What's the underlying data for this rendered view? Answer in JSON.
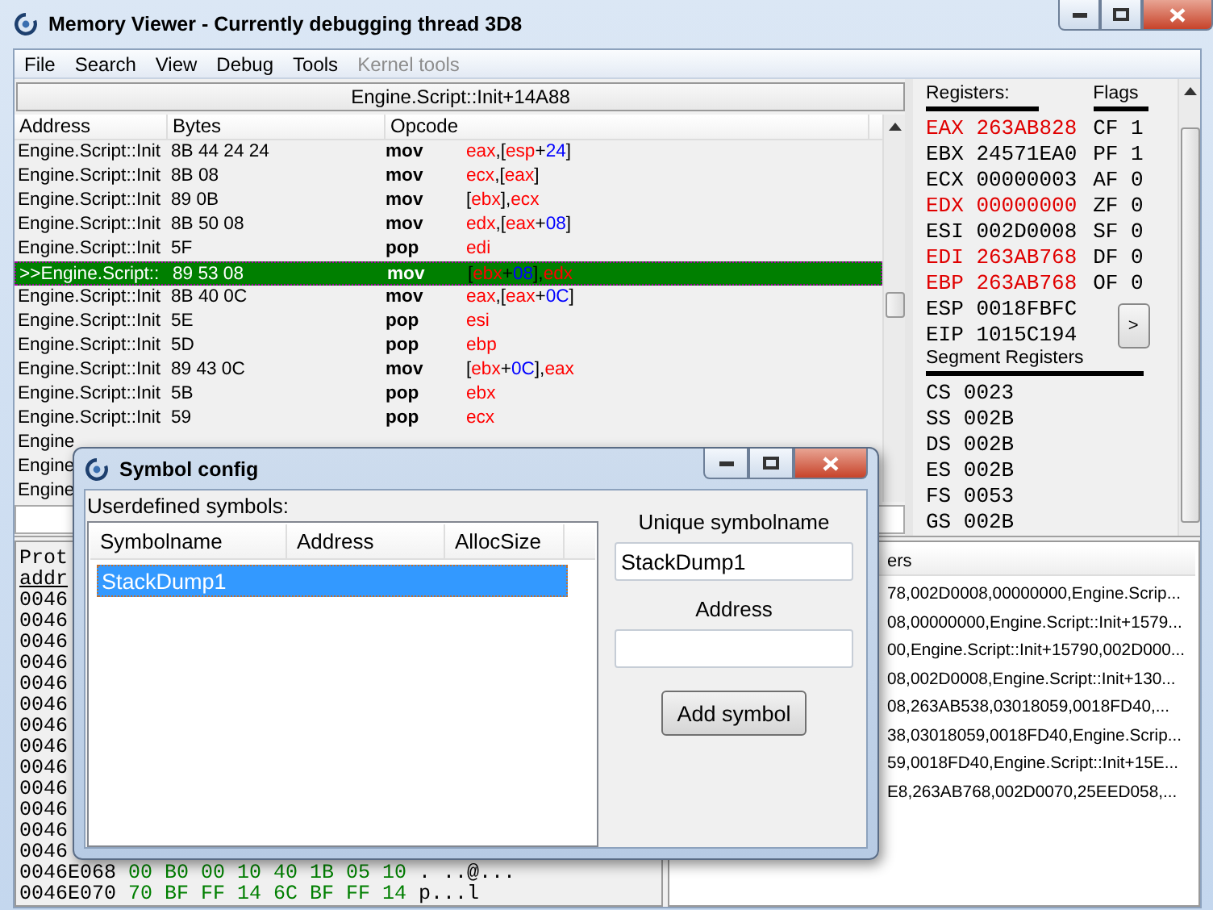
{
  "window": {
    "title": "Memory Viewer - Currently debugging thread 3D8"
  },
  "menu": [
    {
      "label": "File",
      "disabled": false
    },
    {
      "label": "Search",
      "disabled": false
    },
    {
      "label": "View",
      "disabled": false
    },
    {
      "label": "Debug",
      "disabled": false
    },
    {
      "label": "Tools",
      "disabled": false
    },
    {
      "label": "Kernel tools",
      "disabled": true
    }
  ],
  "address_bar": "Engine.Script::Init+14A88",
  "disassembly": {
    "columns": [
      "Address",
      "Bytes",
      "Opcode"
    ],
    "rows": [
      {
        "address": "Engine.Script::Init",
        "bytes": "8B 44 24 24",
        "mnemonic": "mov",
        "operands": [
          {
            "text": "eax",
            "kind": "reg"
          },
          {
            "text": ",[",
            "kind": "sym"
          },
          {
            "text": "esp",
            "kind": "reg"
          },
          {
            "text": "+",
            "kind": "sym"
          },
          {
            "text": "24",
            "kind": "num"
          },
          {
            "text": "]",
            "kind": "sym"
          }
        ],
        "selected": false
      },
      {
        "address": "Engine.Script::Init",
        "bytes": "8B 08",
        "mnemonic": "mov",
        "operands": [
          {
            "text": "ecx",
            "kind": "reg"
          },
          {
            "text": ",[",
            "kind": "sym"
          },
          {
            "text": "eax",
            "kind": "reg"
          },
          {
            "text": "]",
            "kind": "sym"
          }
        ],
        "selected": false
      },
      {
        "address": "Engine.Script::Init",
        "bytes": "89 0B",
        "mnemonic": "mov",
        "operands": [
          {
            "text": "[",
            "kind": "sym"
          },
          {
            "text": "ebx",
            "kind": "reg"
          },
          {
            "text": "],",
            "kind": "sym"
          },
          {
            "text": "ecx",
            "kind": "reg"
          }
        ],
        "selected": false
      },
      {
        "address": "Engine.Script::Init",
        "bytes": "8B 50 08",
        "mnemonic": "mov",
        "operands": [
          {
            "text": "edx",
            "kind": "reg"
          },
          {
            "text": ",[",
            "kind": "sym"
          },
          {
            "text": "eax",
            "kind": "reg"
          },
          {
            "text": "+",
            "kind": "sym"
          },
          {
            "text": "08",
            "kind": "num"
          },
          {
            "text": "]",
            "kind": "sym"
          }
        ],
        "selected": false
      },
      {
        "address": "Engine.Script::Init",
        "bytes": "5F",
        "mnemonic": "pop",
        "operands": [
          {
            "text": "edi",
            "kind": "reg"
          }
        ],
        "selected": false
      },
      {
        "address": ">>Engine.Script::",
        "bytes": "89 53 08",
        "mnemonic": "mov",
        "operands": [
          {
            "text": "[",
            "kind": "sym"
          },
          {
            "text": "ebx",
            "kind": "reg"
          },
          {
            "text": "+",
            "kind": "sym"
          },
          {
            "text": "08",
            "kind": "num"
          },
          {
            "text": "],",
            "kind": "sym"
          },
          {
            "text": "edx",
            "kind": "reg"
          }
        ],
        "selected": true
      },
      {
        "address": "Engine.Script::Init",
        "bytes": "8B 40 0C",
        "mnemonic": "mov",
        "operands": [
          {
            "text": "eax",
            "kind": "reg"
          },
          {
            "text": ",[",
            "kind": "sym"
          },
          {
            "text": "eax",
            "kind": "reg"
          },
          {
            "text": "+",
            "kind": "sym"
          },
          {
            "text": "0C",
            "kind": "num"
          },
          {
            "text": "]",
            "kind": "sym"
          }
        ],
        "selected": false
      },
      {
        "address": "Engine.Script::Init",
        "bytes": "5E",
        "mnemonic": "pop",
        "operands": [
          {
            "text": "esi",
            "kind": "reg"
          }
        ],
        "selected": false
      },
      {
        "address": "Engine.Script::Init",
        "bytes": "5D",
        "mnemonic": "pop",
        "operands": [
          {
            "text": "ebp",
            "kind": "reg"
          }
        ],
        "selected": false
      },
      {
        "address": "Engine.Script::Init",
        "bytes": "89 43 0C",
        "mnemonic": "mov",
        "operands": [
          {
            "text": "[",
            "kind": "sym"
          },
          {
            "text": "ebx",
            "kind": "reg"
          },
          {
            "text": "+",
            "kind": "sym"
          },
          {
            "text": "0C",
            "kind": "num"
          },
          {
            "text": "],",
            "kind": "sym"
          },
          {
            "text": "eax",
            "kind": "reg"
          }
        ],
        "selected": false
      },
      {
        "address": "Engine.Script::Init",
        "bytes": "5B",
        "mnemonic": "pop",
        "operands": [
          {
            "text": "ebx",
            "kind": "reg"
          }
        ],
        "selected": false
      },
      {
        "address": "Engine.Script::Init",
        "bytes": "59",
        "mnemonic": "pop",
        "operands": [
          {
            "text": "ecx",
            "kind": "reg"
          }
        ],
        "selected": false
      },
      {
        "address": "Engine",
        "selected": false
      },
      {
        "address": "Engine",
        "selected": false
      },
      {
        "address": "Engine",
        "selected": false
      }
    ]
  },
  "registers": {
    "title": "Registers:",
    "items": [
      {
        "name": "EAX",
        "value": "263AB828",
        "changed": true
      },
      {
        "name": "EBX",
        "value": "24571EA0",
        "changed": false
      },
      {
        "name": "ECX",
        "value": "00000003",
        "changed": false
      },
      {
        "name": "EDX",
        "value": "00000000",
        "changed": true
      },
      {
        "name": "ESI",
        "value": "002D0008",
        "changed": false
      },
      {
        "name": "EDI",
        "value": "263AB768",
        "changed": true
      },
      {
        "name": "EBP",
        "value": "263AB768",
        "changed": true
      },
      {
        "name": "ESP",
        "value": "0018FBFC",
        "changed": false
      },
      {
        "name": "EIP",
        "value": "1015C194",
        "changed": false
      }
    ]
  },
  "flags": {
    "title": "Flags",
    "items": [
      {
        "name": "CF",
        "value": "1"
      },
      {
        "name": "PF",
        "value": "1"
      },
      {
        "name": "AF",
        "value": "0"
      },
      {
        "name": "ZF",
        "value": "0"
      },
      {
        "name": "SF",
        "value": "0"
      },
      {
        "name": "DF",
        "value": "0"
      },
      {
        "name": "OF",
        "value": "0"
      }
    ],
    "button": ">"
  },
  "segment_registers": {
    "title": "Segment Registers",
    "items": [
      {
        "name": "CS",
        "value": "0023"
      },
      {
        "name": "SS",
        "value": "002B"
      },
      {
        "name": "DS",
        "value": "002B"
      },
      {
        "name": "ES",
        "value": "002B"
      },
      {
        "name": "FS",
        "value": "0053"
      },
      {
        "name": "GS",
        "value": "002B"
      }
    ]
  },
  "hex_view": {
    "protection": "Prot",
    "header": "addr",
    "rows": [
      {
        "address": "0046"
      },
      {
        "address": "0046"
      },
      {
        "address": "0046"
      },
      {
        "address": "0046"
      },
      {
        "address": "0046"
      },
      {
        "address": "0046"
      },
      {
        "address": "0046"
      },
      {
        "address": "0046"
      },
      {
        "address": "0046"
      },
      {
        "address": "0046"
      },
      {
        "address": "0046"
      },
      {
        "address": "0046"
      },
      {
        "address": "0046"
      },
      {
        "address": "0046E068",
        "bytes": "00 B0 00 10 40 1B 05 10",
        "ascii": ". ..@..."
      },
      {
        "address": "0046E070",
        "bytes": "70 BF FF 14 6C BF FF 14",
        "ascii": "p...l"
      }
    ]
  },
  "stack_view": {
    "header": "ers",
    "rows": [
      "78,002D0008,00000000,Engine.Scrip...",
      "08,00000000,Engine.Script::Init+1579...",
      "00,Engine.Script::Init+15790,002D000...",
      "08,002D0008,Engine.Script::Init+130...",
      "08,263AB538,03018059,0018FD40,...",
      "38,03018059,0018FD40,Engine.Scrip...",
      "59,0018FD40,Engine.Script::Init+15E...",
      "E8,263AB768,002D0070,25EED058,..."
    ]
  },
  "dialog": {
    "title": "Symbol config",
    "list_label": "Userdefined symbols:",
    "columns": [
      "Symbolname",
      "Address",
      "AllocSize"
    ],
    "symbols": [
      {
        "name": "StackDump1",
        "selected": true
      }
    ],
    "name_label": "Unique symbolname",
    "name_value": "StackDump1",
    "address_label": "Address",
    "button": "Add symbol"
  }
}
